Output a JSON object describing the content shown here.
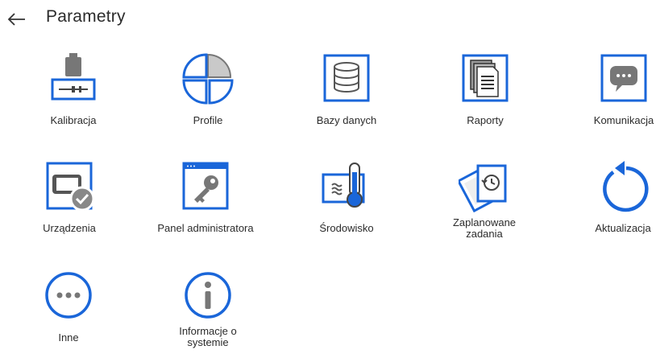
{
  "header": {
    "title": "Parametry"
  },
  "icons": {
    "back": "arrow-left-icon"
  },
  "colors": {
    "accent": "#1a66d9",
    "icon_gray": "#6f6f6f",
    "light_gray": "#c9c9c9"
  },
  "tiles": [
    {
      "label": "Kalibracja"
    },
    {
      "label": "Profile"
    },
    {
      "label": "Bazy danych"
    },
    {
      "label": "Raporty"
    },
    {
      "label": "Komunikacja"
    },
    {
      "label": "Urządzenia"
    },
    {
      "label": "Panel administratora"
    },
    {
      "label": "Środowisko"
    },
    {
      "label_line1": "Zaplanowane",
      "label_line2": "zadania"
    },
    {
      "label": "Aktualizacja"
    },
    {
      "label": "Inne"
    },
    {
      "label_line1": "Informacje o",
      "label_line2": "systemie"
    }
  ]
}
